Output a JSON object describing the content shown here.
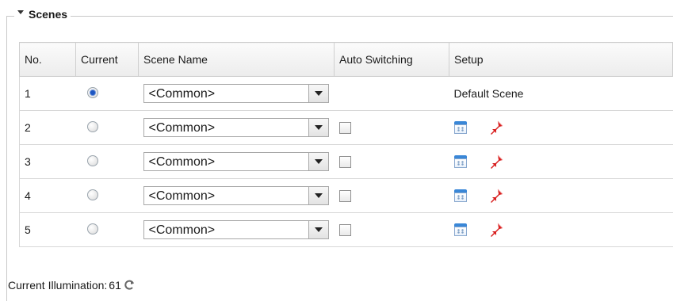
{
  "section": {
    "title": "Scenes"
  },
  "table": {
    "columns": [
      "No.",
      "Current",
      "Scene Name",
      "Auto Switching",
      "Setup"
    ],
    "rows": [
      {
        "no": "1",
        "current": true,
        "scene": "<Common>",
        "auto": null,
        "setup_text": "Default Scene"
      },
      {
        "no": "2",
        "current": false,
        "scene": "<Common>",
        "auto": false,
        "setup_text": null
      },
      {
        "no": "3",
        "current": false,
        "scene": "<Common>",
        "auto": false,
        "setup_text": null
      },
      {
        "no": "4",
        "current": false,
        "scene": "<Common>",
        "auto": false,
        "setup_text": null
      },
      {
        "no": "5",
        "current": false,
        "scene": "<Common>",
        "auto": false,
        "setup_text": null
      }
    ]
  },
  "footer": {
    "label": "Current Illumination:",
    "value": "61"
  },
  "icons": {
    "collapse": "triangle-down-icon",
    "select_arrow": "chevron-down-icon",
    "setup_calendar": "calendar-icon",
    "setup_pin": "pin-icon",
    "refresh": "refresh-icon"
  },
  "colors": {
    "radio_selected": "#1e56c2",
    "calendar": "#3a87d7",
    "pin": "#d81e1e"
  }
}
